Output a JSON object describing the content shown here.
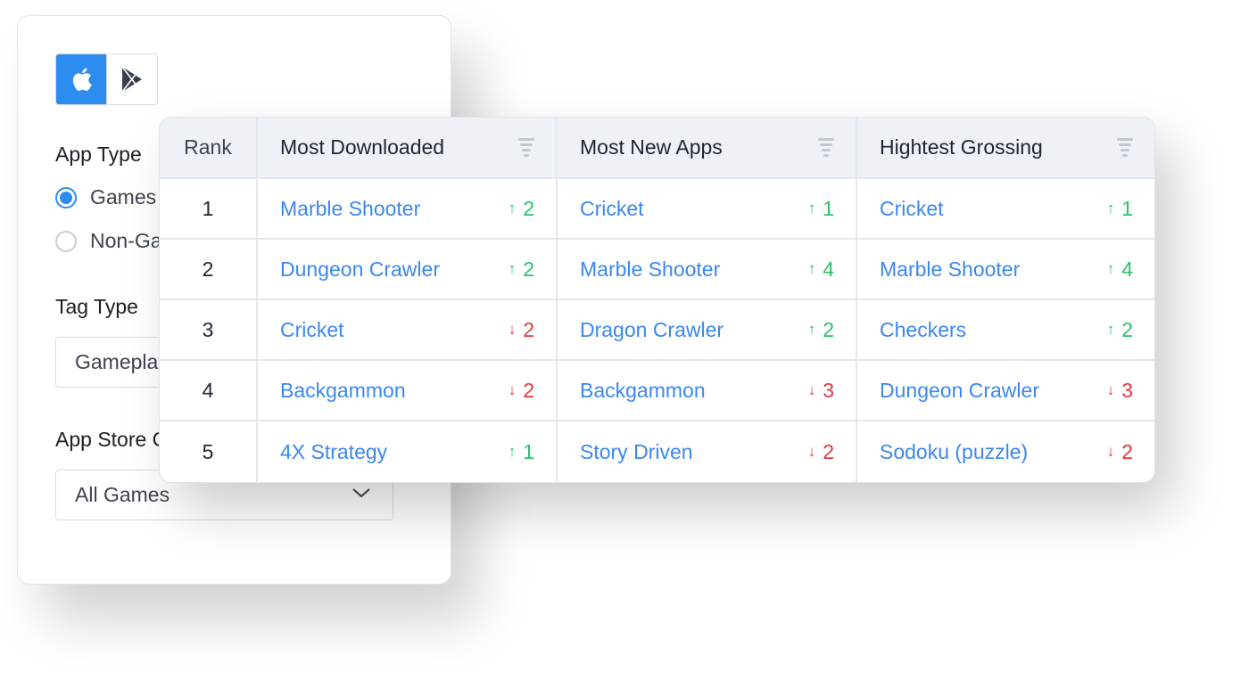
{
  "filters": {
    "store_toggle": [
      {
        "icon": "apple-icon",
        "label": "App Store",
        "active": true
      },
      {
        "icon": "google-play-icon",
        "label": "Google Play",
        "active": false
      }
    ],
    "app_type": {
      "label": "App Type",
      "options": [
        {
          "label": "Games",
          "checked": true
        },
        {
          "label": "Non-Games",
          "checked": false
        }
      ]
    },
    "tag_type": {
      "label": "Tag Type",
      "value": "Gameplay"
    },
    "app_store_category": {
      "label": "App Store Category",
      "value": "All Games"
    }
  },
  "table": {
    "headers": {
      "rank": "Rank",
      "columns": [
        "Most Downloaded",
        "Most New Apps",
        "Hightest Grossing"
      ]
    },
    "rows": [
      {
        "rank": "1",
        "cells": [
          {
            "name": "Marble Shooter",
            "dir": "up",
            "arrow": "↑",
            "change": "2"
          },
          {
            "name": "Cricket",
            "dir": "up",
            "arrow": "↑",
            "change": "1"
          },
          {
            "name": "Cricket",
            "dir": "up",
            "arrow": "↑",
            "change": "1"
          }
        ]
      },
      {
        "rank": "2",
        "cells": [
          {
            "name": "Dungeon Crawler",
            "dir": "up",
            "arrow": "↑",
            "change": "2"
          },
          {
            "name": "Marble Shooter",
            "dir": "up",
            "arrow": "↑",
            "change": "4"
          },
          {
            "name": "Marble Shooter",
            "dir": "up",
            "arrow": "↑",
            "change": "4"
          }
        ]
      },
      {
        "rank": "3",
        "cells": [
          {
            "name": "Cricket",
            "dir": "down",
            "arrow": "↓",
            "change": "2"
          },
          {
            "name": "Dragon Crawler",
            "dir": "up",
            "arrow": "↑",
            "change": "2"
          },
          {
            "name": "Checkers",
            "dir": "up",
            "arrow": "↑",
            "change": "2"
          }
        ]
      },
      {
        "rank": "4",
        "cells": [
          {
            "name": "Backgammon",
            "dir": "down",
            "arrow": "↓",
            "change": "2"
          },
          {
            "name": "Backgammon",
            "dir": "down",
            "arrow": "↓",
            "change": "3"
          },
          {
            "name": "Dungeon Crawler",
            "dir": "down",
            "arrow": "↓",
            "change": "3"
          }
        ]
      },
      {
        "rank": "5",
        "cells": [
          {
            "name": "4X Strategy",
            "dir": "up",
            "arrow": "↑",
            "change": "1"
          },
          {
            "name": "Story Driven",
            "dir": "down",
            "arrow": "↓",
            "change": "2"
          },
          {
            "name": "Sodoku (puzzle)",
            "dir": "down",
            "arrow": "↓",
            "change": "2"
          }
        ]
      }
    ]
  },
  "colors": {
    "accent": "#2d8cf0",
    "link": "#3b87f0",
    "up": "#27c26c",
    "down": "#e5363d",
    "header_bg": "#eef1f6"
  }
}
